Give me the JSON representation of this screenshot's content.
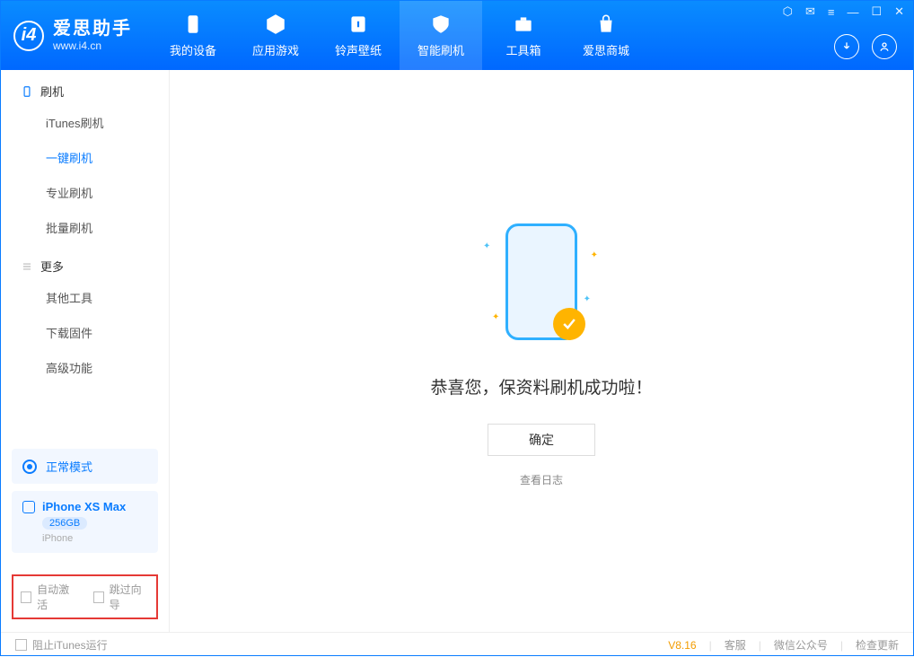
{
  "app": {
    "name": "爱思助手",
    "site": "www.i4.cn"
  },
  "nav": {
    "tabs": [
      {
        "label": "我的设备"
      },
      {
        "label": "应用游戏"
      },
      {
        "label": "铃声壁纸"
      },
      {
        "label": "智能刷机"
      },
      {
        "label": "工具箱"
      },
      {
        "label": "爱思商城"
      }
    ],
    "active_index": 3
  },
  "sidebar": {
    "group_flash": "刷机",
    "items_flash": [
      {
        "label": "iTunes刷机"
      },
      {
        "label": "一键刷机"
      },
      {
        "label": "专业刷机"
      },
      {
        "label": "批量刷机"
      }
    ],
    "active_flash_index": 1,
    "group_more": "更多",
    "items_more": [
      {
        "label": "其他工具"
      },
      {
        "label": "下载固件"
      },
      {
        "label": "高级功能"
      }
    ],
    "status_label": "正常模式",
    "device_name": "iPhone XS Max",
    "device_capacity": "256GB",
    "device_type": "iPhone",
    "check_auto_activate": "自动激活",
    "check_skip_guide": "跳过向导"
  },
  "main": {
    "success_title": "恭喜您，保资料刷机成功啦！",
    "confirm_label": "确定",
    "view_log_label": "查看日志"
  },
  "footer": {
    "block_itunes": "阻止iTunes运行",
    "version": "V8.16",
    "links": [
      {
        "label": "客服"
      },
      {
        "label": "微信公众号"
      },
      {
        "label": "检查更新"
      }
    ]
  }
}
